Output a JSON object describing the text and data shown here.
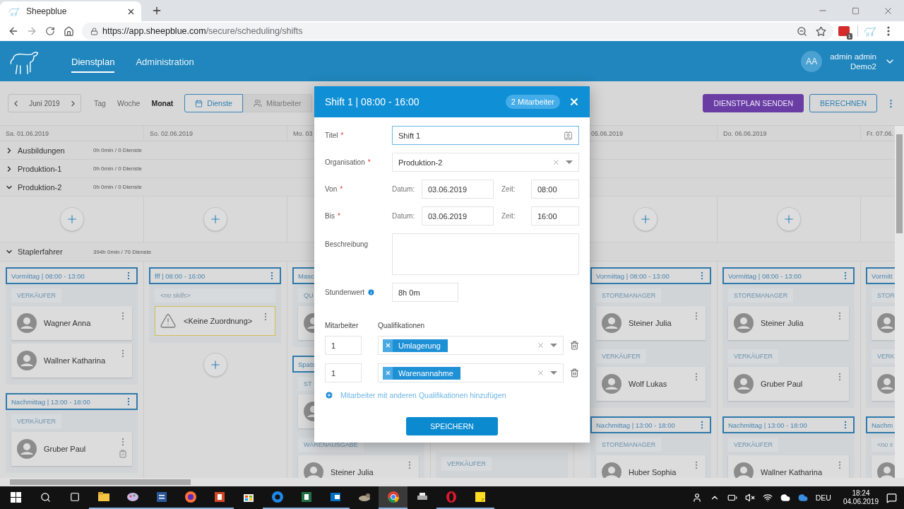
{
  "browser": {
    "tab_title": "Sheepblue",
    "url_host": "https://app.sheepblue.com",
    "url_path": "/secure/scheduling/shifts",
    "extension_badge": "1"
  },
  "header": {
    "nav": [
      {
        "label": "Dienstplan",
        "selected": true
      },
      {
        "label": "Administration",
        "selected": false
      }
    ],
    "user": {
      "initials": "AA",
      "name": "admin admin",
      "org": "Demo2"
    }
  },
  "toolbar": {
    "month": "Juni 2019",
    "ranges": [
      {
        "label": "Tag",
        "selected": false
      },
      {
        "label": "Woche",
        "selected": false
      },
      {
        "label": "Monat",
        "selected": true
      }
    ],
    "views": [
      {
        "label": "Dienste",
        "kind": "calendar",
        "selected": true
      },
      {
        "label": "Mitarbeiter",
        "kind": "people",
        "selected": false
      }
    ],
    "actions": [
      {
        "label": "DIENSTPLAN SENDEN",
        "kind": "primary"
      },
      {
        "label": "BERECHNEN",
        "kind": "outline"
      }
    ]
  },
  "days": [
    {
      "label": "Sa. 01.06.2019"
    },
    {
      "label": "So. 02.06.2019"
    },
    {
      "label": "Mo. 03"
    },
    {
      "label": "05.06.2019"
    },
    {
      "label": "Do. 06.06.2019"
    },
    {
      "label": "Fr. 07.06."
    }
  ],
  "groups": [
    {
      "name": "Ausbildungen",
      "stats": "0h 0min / 0 Dienste",
      "expanded": false
    },
    {
      "name": "Produktion-1",
      "stats": "0h 0min / 0 Dienste",
      "expanded": false
    },
    {
      "name": "Produktion-2",
      "stats": "0h 0min / 0 Dienste",
      "expanded": true,
      "add_button": true
    },
    {
      "name": "Staplerfahrer",
      "stats": "394h 0min / 70 Dienste",
      "expanded": true,
      "slots": [
        {
          "shifts": [
            {
              "title": "Vormittag | 08:00 - 13:00",
              "groups": [
                {
                  "kind": "skill",
                  "label": "VERKÄUFER",
                  "people": [
                    {
                      "kind": "person",
                      "name": "Wagner Anna",
                      "confirmed": false
                    },
                    {
                      "kind": "person",
                      "name": "Wallner Katharina",
                      "confirmed": false
                    }
                  ]
                }
              ]
            },
            {
              "title": "Nachmittag | 13:00 - 18:00",
              "groups": [
                {
                  "kind": "skill",
                  "label": "VERKÄUFER",
                  "people": [
                    {
                      "kind": "person",
                      "name": "Gruber Paul",
                      "confirmed": true
                    }
                  ]
                }
              ]
            }
          ]
        },
        {
          "add_button": true,
          "shifts": [
            {
              "title": "fff | 08:00 - 16:00",
              "groups": [
                {
                  "kind": "none",
                  "label": "<no skills>",
                  "people": [
                    {
                      "kind": "unassigned",
                      "name": "<Keine Zuordnung>"
                    }
                  ]
                }
              ]
            }
          ]
        },
        {
          "shifts": [
            {
              "title": "Masc",
              "groups": [
                {
                  "kind": "skill",
                  "label": "QU",
                  "people": [
                    {
                      "kind": "person",
                      "confirmed": false
                    }
                  ]
                }
              ]
            },
            {
              "title": "Spats",
              "groups": [
                {
                  "kind": "skill",
                  "label": "ST",
                  "people": [
                    {
                      "kind": "person",
                      "confirmed": false
                    }
                  ]
                },
                {
                  "kind": "skill",
                  "label": "WARENAUSGABE",
                  "people": [
                    {
                      "kind": "person",
                      "name": "Steiner Julia",
                      "confirmed": false
                    }
                  ]
                }
              ]
            }
          ]
        },
        {
          "shifts": [
            {
              "groups": [
                {
                  "kind": "skill",
                  "label": "VERKÄUFER"
                }
              ]
            }
          ]
        },
        {
          "shifts": [
            {
              "title": "Vormittag | 08:00 - 13:00",
              "groups": [
                {
                  "kind": "skill",
                  "label": "STOREMANAGER",
                  "people": [
                    {
                      "kind": "person",
                      "name": "Steiner Julia",
                      "confirmed": false
                    }
                  ]
                },
                {
                  "kind": "skill",
                  "label": "VERKÄUFER",
                  "people": [
                    {
                      "kind": "person",
                      "name": "Wolf Lukas",
                      "confirmed": false
                    }
                  ]
                }
              ]
            },
            {
              "title": "Nachmittag | 13:00 - 18:00",
              "groups": [
                {
                  "kind": "skill",
                  "label": "STOREMANAGER",
                  "people": [
                    {
                      "kind": "person",
                      "name": "Huber Sophia",
                      "confirmed": false
                    }
                  ]
                }
              ]
            }
          ]
        },
        {
          "shifts": [
            {
              "title": "Vormittag | 08:00 - 13:00",
              "groups": [
                {
                  "kind": "skill",
                  "label": "STOREMANAGER",
                  "people": [
                    {
                      "kind": "person",
                      "name": "Steiner Julia",
                      "confirmed": false
                    }
                  ]
                },
                {
                  "kind": "skill",
                  "label": "VERKÄUFER",
                  "people": [
                    {
                      "kind": "person",
                      "name": "Gruber Paul",
                      "confirmed": false
                    }
                  ]
                }
              ]
            },
            {
              "title": "Nachmittag | 13:00 - 18:00",
              "groups": [
                {
                  "kind": "skill",
                  "label": "VERKÄUFER",
                  "people": [
                    {
                      "kind": "person",
                      "name": "Wallner Katharina",
                      "confirmed": false
                    }
                  ]
                }
              ]
            }
          ]
        },
        {
          "shifts": [
            {
              "title": "Vormitt",
              "groups": [
                {
                  "kind": "skill",
                  "label": "STOR",
                  "people": [
                    {
                      "kind": "person",
                      "confirmed": false
                    }
                  ]
                },
                {
                  "kind": "skill",
                  "label": "VERK",
                  "people": [
                    {
                      "kind": "person",
                      "confirmed": false
                    }
                  ]
                }
              ]
            },
            {
              "title": "Nachm",
              "groups": [
                {
                  "kind": "none",
                  "label": "<no s",
                  "people": [
                    {
                      "kind": "person",
                      "confirmed": false
                    }
                  ]
                }
              ]
            }
          ]
        }
      ]
    }
  ],
  "dialog": {
    "title": "Shift 1 | 08:00 - 16:00",
    "badge": "2 Mitarbeiter",
    "title_field": {
      "label": "Titel",
      "mark": "*",
      "value": "Shift 1"
    },
    "organisation": {
      "label": "Organisation",
      "mark": "*",
      "value": "Produktion-2"
    },
    "from": {
      "label": "Von",
      "mark": "*",
      "date_label": "Datum:",
      "date": "03.06.2019",
      "time_label": "Zeit:",
      "time": "08:00"
    },
    "to": {
      "label": "Bis",
      "mark": "*",
      "date_label": "Datum:",
      "date": "03.06.2019",
      "time_label": "Zeit:",
      "time": "16:00"
    },
    "description": {
      "label": "Beschreibung"
    },
    "hours": {
      "label": "Stundenwert",
      "value": "8h 0m"
    },
    "staff_header": {
      "count": "Mitarbeiter",
      "qualifications": "Qualifikationen"
    },
    "staff": [
      {
        "count": "1",
        "qualification": "Umlagerung"
      },
      {
        "count": "1",
        "qualification": "Warenannahme"
      }
    ],
    "add_link": "Mitarbeiter mit anderen Qualifikationen hinzufügen",
    "save": "SPEICHERN"
  },
  "taskbar": {
    "apps": [
      {
        "kind": "folder",
        "running": true,
        "selected": false
      },
      {
        "kind": "palette",
        "running": true,
        "selected": false
      },
      {
        "kind": "document",
        "running": true,
        "selected": false
      },
      {
        "kind": "globe",
        "running": true,
        "selected": false
      },
      {
        "kind": "slides",
        "running": true,
        "selected": false
      },
      {
        "kind": "bag",
        "running": false,
        "selected": false
      },
      {
        "kind": "browser",
        "running": true,
        "selected": false
      },
      {
        "kind": "sheet",
        "running": true,
        "selected": false
      },
      {
        "kind": "mail",
        "running": true,
        "selected": false
      },
      {
        "kind": "animal",
        "running": false,
        "selected": false
      },
      {
        "kind": "chrome",
        "running": true,
        "selected": true
      },
      {
        "kind": "printer",
        "running": false,
        "selected": false
      },
      {
        "kind": "ring",
        "running": true,
        "selected": false
      },
      {
        "kind": "note",
        "running": true,
        "selected": false
      }
    ],
    "tray": {
      "language": "DEU",
      "time": "18:24",
      "date": "04.06.2019"
    }
  }
}
